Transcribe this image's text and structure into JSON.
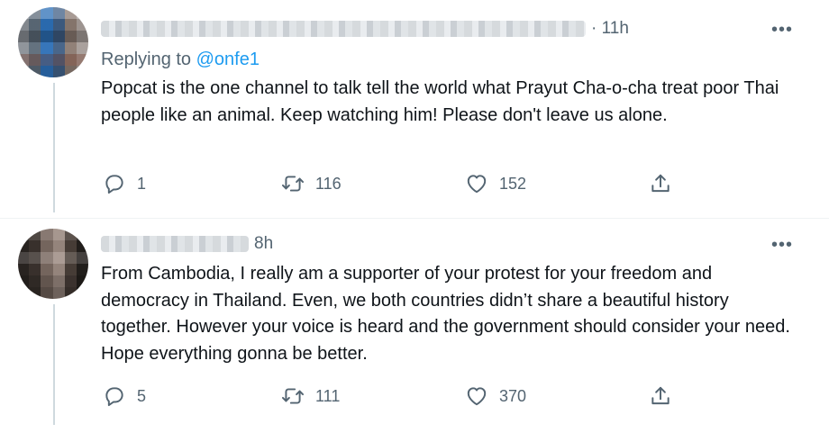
{
  "tweets": [
    {
      "time": "· 11h",
      "reply_prefix": "Replying to",
      "reply_handle": "@onfe1",
      "text": "Popcat is the one channel to talk tell the world what Prayut Cha-o-cha treat poor Thai people like an animal. Keep watching him! Please don't leave us alone.",
      "replies": "1",
      "retweets": "116",
      "likes": "152",
      "more": "•••"
    },
    {
      "time": "8h",
      "text": "From Cambodia, I really am a supporter of your protest for your freedom and democracy in Thailand. Even, we both countries didn’t share a beautiful history together. However your voice is heard and the government should consider your need. Hope everything gonna be better.",
      "replies": "5",
      "retweets": "111",
      "likes": "370",
      "more": "•••"
    }
  ],
  "colors": {
    "text": "#0f1419",
    "secondary": "#536471",
    "link": "#1d9bf0",
    "thread_line": "#cfd9de"
  },
  "icons": {
    "reply": "reply-icon",
    "retweet": "retweet-icon",
    "like": "heart-icon",
    "share": "share-icon",
    "more": "more-icon"
  }
}
